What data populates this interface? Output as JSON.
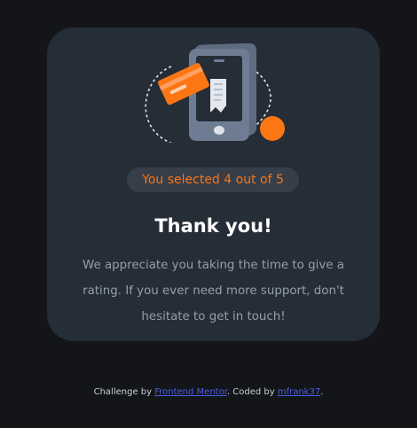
{
  "card": {
    "selection_text": "You selected 4 out of 5",
    "title": "Thank you!",
    "message": "We appreciate you taking the time to give a rating. If you ever need more support, don't hesitate to get in touch!",
    "illustration_icon": "payment-receipt-phone-illustration"
  },
  "footer": {
    "prefix": "Challenge by ",
    "link1": "Frontend Mentor",
    "middle": ". Coded by ",
    "link2": "mfrank37",
    "suffix": "."
  },
  "colors": {
    "background": "#131518",
    "card": "#252d37",
    "accent": "#fb7413",
    "pill": "#363e49",
    "text_muted": "#959eac",
    "link": "#4a5ee8"
  }
}
